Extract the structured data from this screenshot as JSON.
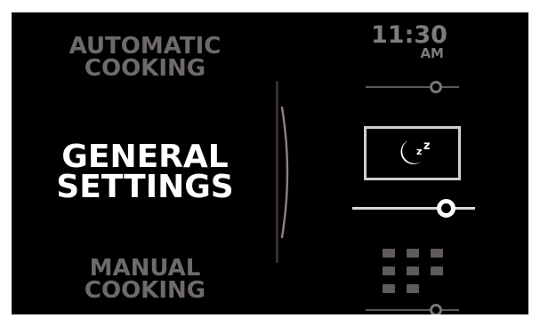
{
  "menu": {
    "automatic_cooking": {
      "line1": "AUTOMATIC",
      "line2": "COOKING"
    },
    "general_settings": {
      "line1": "GENERAL",
      "line2": "SETTINGS"
    },
    "manual_cooking": {
      "line1": "MANUAL",
      "line2": "COOKING"
    },
    "selected": "general_settings"
  },
  "clock": {
    "time": "11:30",
    "period": "AM"
  },
  "sleep_mode": {
    "icon": "sleep-moon-icon",
    "label": "z",
    "label_small": "z"
  },
  "keypad": {
    "icon": "keypad-grid-icon"
  },
  "colors": {
    "background": "#000000",
    "selected_text": "#ffffff",
    "unselected_text": "#6e6a6a",
    "active_control": "#ffffff",
    "inactive_control": "#7a7676"
  }
}
